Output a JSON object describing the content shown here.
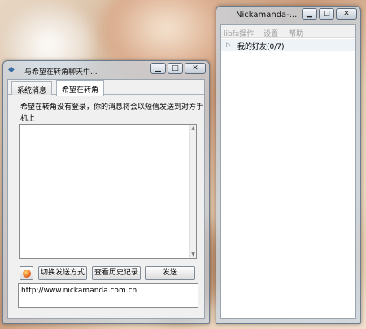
{
  "chat_window": {
    "title": "与希望在转角聊天中...",
    "controls": {
      "minimize": "▁",
      "maximize": "□",
      "close": "✕"
    },
    "tabs": [
      {
        "label": "系统消息"
      },
      {
        "label": "希望在转角"
      }
    ],
    "notice": "希望在转角没有登录，你的消息将会以短信发送到对方手机上",
    "toolbar": {
      "switch_send_label": "切换发送方式",
      "history_label": "查看历史记录",
      "send_label": "发送"
    },
    "input_value": "http://www.nickamanda.com.cn"
  },
  "main_window": {
    "title": "Nickamanda-...",
    "controls": {
      "minimize": "▁",
      "maximize": "□",
      "close": "✕"
    },
    "menu": [
      {
        "label": "libfx操作"
      },
      {
        "label": "设置"
      },
      {
        "label": "帮助"
      }
    ],
    "groups": [
      {
        "label": "我的好友(0/7)"
      }
    ]
  },
  "colors": {
    "title_text": "#111111",
    "menu_disabled": "#9c9c9c",
    "group_row_bg": "#eef3f8"
  }
}
